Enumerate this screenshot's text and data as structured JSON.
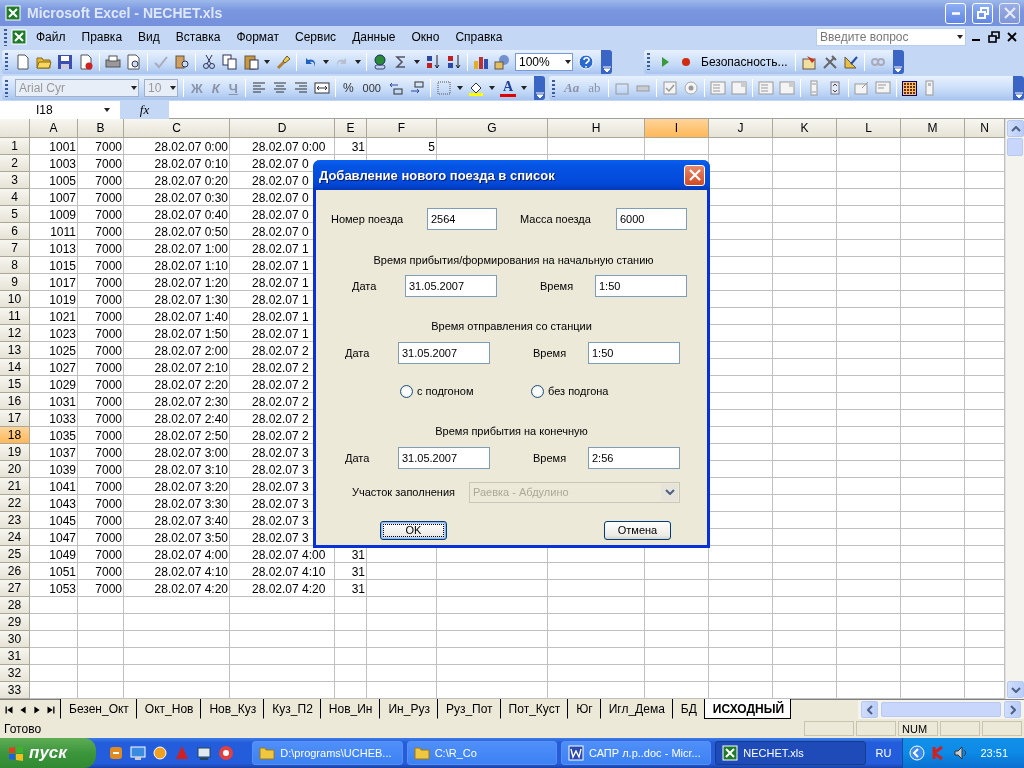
{
  "window": {
    "title": "Microsoft Excel - NECHET.xls"
  },
  "menu": [
    "Файл",
    "Правка",
    "Вид",
    "Вставка",
    "Формат",
    "Сервис",
    "Данные",
    "Окно",
    "Справка"
  ],
  "help_box": {
    "placeholder": "Введите вопрос"
  },
  "standard_toolbar": {
    "zoom": "100%"
  },
  "macro_toolbar": {
    "security": "Безопасность..."
  },
  "formatting_toolbar": {
    "font": "Arial Cyr",
    "size": "10",
    "bold": "Ж",
    "italic": "К",
    "underline": "Ч",
    "percent": "%",
    "thousands": "000",
    "font_color": "A"
  },
  "forms_toolbar": {
    "label_tool": "Aa",
    "edit_box_tool": "ab",
    "grid_on": true
  },
  "formula_bar": {
    "name_box": "I18",
    "fx": "fx"
  },
  "columns": [
    {
      "label": "A",
      "selected": false
    },
    {
      "label": "B",
      "selected": false
    },
    {
      "label": "C",
      "selected": false
    },
    {
      "label": "D",
      "selected": false
    },
    {
      "label": "E",
      "selected": false
    },
    {
      "label": "F",
      "selected": false
    },
    {
      "label": "G",
      "selected": false
    },
    {
      "label": "H",
      "selected": false
    },
    {
      "label": "I",
      "selected": true
    },
    {
      "label": "J",
      "selected": false
    },
    {
      "label": "K",
      "selected": false
    },
    {
      "label": "L",
      "selected": false
    },
    {
      "label": "M",
      "selected": false
    },
    {
      "label": "N",
      "selected": false
    }
  ],
  "rows": [
    {
      "header": "1",
      "selected": false,
      "cells": [
        "1001",
        "7000",
        "28.02.07 0:00",
        "28.02.07 0:00",
        "31",
        "5"
      ]
    },
    {
      "header": "2",
      "selected": false,
      "cells": [
        "1003",
        "7000",
        "28.02.07 0:10",
        "28.02.07 0"
      ]
    },
    {
      "header": "3",
      "selected": false,
      "cells": [
        "1005",
        "7000",
        "28.02.07 0:20",
        "28.02.07 0"
      ]
    },
    {
      "header": "4",
      "selected": false,
      "cells": [
        "1007",
        "7000",
        "28.02.07 0:30",
        "28.02.07 0"
      ]
    },
    {
      "header": "5",
      "selected": false,
      "cells": [
        "1009",
        "7000",
        "28.02.07 0:40",
        "28.02.07 0"
      ]
    },
    {
      "header": "6",
      "selected": false,
      "cells": [
        "1011",
        "7000",
        "28.02.07 0:50",
        "28.02.07 0"
      ]
    },
    {
      "header": "7",
      "selected": false,
      "cells": [
        "1013",
        "7000",
        "28.02.07 1:00",
        "28.02.07 1"
      ]
    },
    {
      "header": "8",
      "selected": false,
      "cells": [
        "1015",
        "7000",
        "28.02.07 1:10",
        "28.02.07 1"
      ]
    },
    {
      "header": "9",
      "selected": false,
      "cells": [
        "1017",
        "7000",
        "28.02.07 1:20",
        "28.02.07 1"
      ]
    },
    {
      "header": "10",
      "selected": false,
      "cells": [
        "1019",
        "7000",
        "28.02.07 1:30",
        "28.02.07 1"
      ]
    },
    {
      "header": "11",
      "selected": false,
      "cells": [
        "1021",
        "7000",
        "28.02.07 1:40",
        "28.02.07 1"
      ]
    },
    {
      "header": "12",
      "selected": false,
      "cells": [
        "1023",
        "7000",
        "28.02.07 1:50",
        "28.02.07 1"
      ]
    },
    {
      "header": "13",
      "selected": false,
      "cells": [
        "1025",
        "7000",
        "28.02.07 2:00",
        "28.02.07 2"
      ]
    },
    {
      "header": "14",
      "selected": false,
      "cells": [
        "1027",
        "7000",
        "28.02.07 2:10",
        "28.02.07 2"
      ]
    },
    {
      "header": "15",
      "selected": false,
      "cells": [
        "1029",
        "7000",
        "28.02.07 2:20",
        "28.02.07 2"
      ]
    },
    {
      "header": "16",
      "selected": false,
      "cells": [
        "1031",
        "7000",
        "28.02.07 2:30",
        "28.02.07 2"
      ]
    },
    {
      "header": "17",
      "selected": false,
      "cells": [
        "1033",
        "7000",
        "28.02.07 2:40",
        "28.02.07 2"
      ]
    },
    {
      "header": "18",
      "selected": true,
      "cells": [
        "1035",
        "7000",
        "28.02.07 2:50",
        "28.02.07 2"
      ]
    },
    {
      "header": "19",
      "selected": false,
      "cells": [
        "1037",
        "7000",
        "28.02.07 3:00",
        "28.02.07 3"
      ]
    },
    {
      "header": "20",
      "selected": false,
      "cells": [
        "1039",
        "7000",
        "28.02.07 3:10",
        "28.02.07 3"
      ]
    },
    {
      "header": "21",
      "selected": false,
      "cells": [
        "1041",
        "7000",
        "28.02.07 3:20",
        "28.02.07 3"
      ]
    },
    {
      "header": "22",
      "selected": false,
      "cells": [
        "1043",
        "7000",
        "28.02.07 3:30",
        "28.02.07 3"
      ]
    },
    {
      "header": "23",
      "selected": false,
      "cells": [
        "1045",
        "7000",
        "28.02.07 3:40",
        "28.02.07 3"
      ]
    },
    {
      "header": "24",
      "selected": false,
      "cells": [
        "1047",
        "7000",
        "28.02.07 3:50",
        "28.02.07 3"
      ]
    },
    {
      "header": "25",
      "selected": false,
      "cells": [
        "1049",
        "7000",
        "28.02.07 4:00",
        "28.02.07 4:00",
        "31"
      ]
    },
    {
      "header": "26",
      "selected": false,
      "cells": [
        "1051",
        "7000",
        "28.02.07 4:10",
        "28.02.07 4:10",
        "31"
      ]
    },
    {
      "header": "27",
      "selected": false,
      "cells": [
        "1053",
        "7000",
        "28.02.07 4:20",
        "28.02.07 4:20",
        "31"
      ]
    },
    {
      "header": "28",
      "selected": false
    },
    {
      "header": "29",
      "selected": false
    },
    {
      "header": "30",
      "selected": false
    },
    {
      "header": "31",
      "selected": false
    },
    {
      "header": "32",
      "selected": false
    },
    {
      "header": "33",
      "selected": false
    }
  ],
  "dialog": {
    "title": "Добавление нового поезда в список",
    "train_number": {
      "label": "Номер поезда",
      "value": "2564"
    },
    "train_mass": {
      "label": "Масса поезда",
      "value": "6000"
    },
    "sections": [
      {
        "heading": "Время прибытия/формирования на начальную станию",
        "date_label": "Дата",
        "date": "31.05.2007",
        "time_label": "Время",
        "time": "1:50"
      },
      {
        "heading": "Время отправления со станции",
        "date_label": "Дата",
        "date": "31.05.2007",
        "time_label": "Время",
        "time": "1:50"
      },
      {
        "heading": "Время прибытия на конечную",
        "date_label": "Дата",
        "date": "31.05.2007",
        "time_label": "Время",
        "time": "2:56"
      }
    ],
    "options": [
      {
        "label": "с подгоном",
        "selected": false
      },
      {
        "label": "без подгона",
        "selected": false
      }
    ],
    "area": {
      "label": "Участок заполнения",
      "value": "Раевка - Абдулино",
      "disabled": true
    },
    "buttons": [
      {
        "label": "OK",
        "focused": true
      },
      {
        "label": "Отмена",
        "focused": false
      }
    ]
  },
  "sheet_tabs": [
    {
      "label": "Безен_Окт",
      "selected": false
    },
    {
      "label": "Окт_Нов",
      "selected": false
    },
    {
      "label": "Нов_Куз",
      "selected": false
    },
    {
      "label": "Куз_П2",
      "selected": false
    },
    {
      "label": "Нов_Ин",
      "selected": false
    },
    {
      "label": "Ин_Руз",
      "selected": false
    },
    {
      "label": "Руз_Пот",
      "selected": false
    },
    {
      "label": "Пот_Куст",
      "selected": false
    },
    {
      "label": "Юг",
      "selected": false
    },
    {
      "label": "Игл_Дема",
      "selected": false
    },
    {
      "label": "БД",
      "selected": false
    },
    {
      "label": "ИСХОДНЫЙ",
      "selected": true
    }
  ],
  "status_bar": {
    "text": "Готово",
    "num": "NUM"
  },
  "taskbar": {
    "start": "пуск",
    "tasks": [
      {
        "label": "D:\\programs\\UCHEB...",
        "kind": "folder",
        "selected": false
      },
      {
        "label": "C:\\R_Co",
        "kind": "folder",
        "selected": false
      },
      {
        "label": "САПР л.р..doc - Micr...",
        "kind": "word",
        "selected": false
      },
      {
        "label": "NECHET.xls",
        "kind": "excel",
        "selected": true
      }
    ],
    "lang": "RU",
    "clock": "23:51"
  }
}
